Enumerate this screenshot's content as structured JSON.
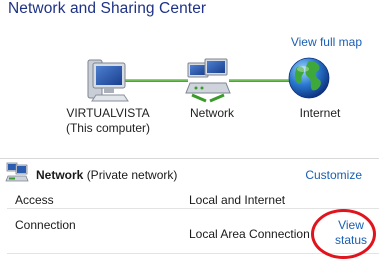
{
  "window": {
    "title": "Network and Sharing Center"
  },
  "map": {
    "view_full_map": "View full map",
    "nodes": [
      {
        "icon": "computer-icon",
        "label_line1": "VIRTUALVISTA",
        "label_line2": "(This computer)"
      },
      {
        "icon": "network-icon",
        "label": "Network"
      },
      {
        "icon": "globe-icon",
        "label": "Internet"
      }
    ]
  },
  "network_section": {
    "icon": "network-icon",
    "name": "Network",
    "type": "(Private network)",
    "customize": "Customize",
    "rows": [
      {
        "key": "Access",
        "value": "Local and Internet"
      },
      {
        "key": "Connection",
        "value": "Local Area Connection",
        "link_line1": "View",
        "link_line2": "status"
      }
    ]
  },
  "colors": {
    "title": "#1e3287",
    "link": "#1a5fb4",
    "annotation_ring": "#e0141e"
  }
}
